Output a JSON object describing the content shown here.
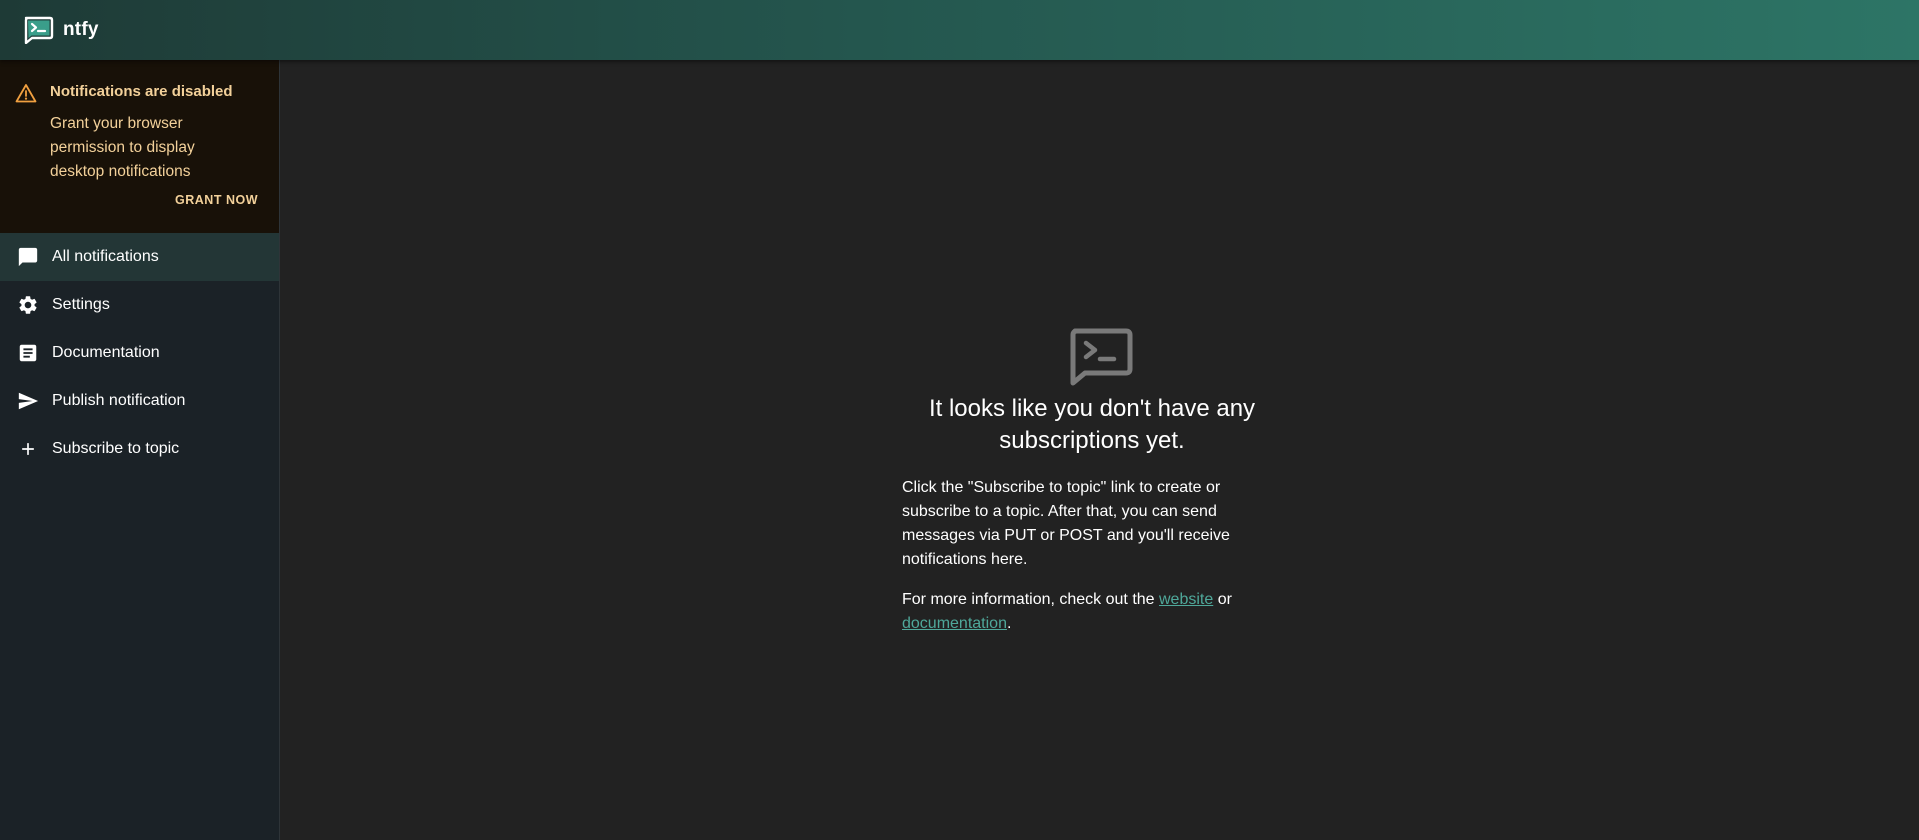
{
  "app": {
    "title": "ntfy",
    "logo_icon": "terminal-message-icon",
    "accent_color": "#338574"
  },
  "alert": {
    "icon": "warning-icon",
    "title": "Notifications are disabled",
    "body": "Grant your browser permission to display desktop notifications",
    "action_label": "GRANT NOW",
    "text_color": "#f3d19a"
  },
  "sidebar": {
    "items": [
      {
        "label": "All notifications",
        "icon": "chat-icon",
        "active": true
      },
      {
        "label": "Settings",
        "icon": "gear-icon",
        "active": false
      },
      {
        "label": "Documentation",
        "icon": "article-icon",
        "active": false
      },
      {
        "label": "Publish notification",
        "icon": "send-icon",
        "active": false
      },
      {
        "label": "Subscribe to topic",
        "icon": "plus-icon",
        "active": false
      }
    ]
  },
  "empty_state": {
    "icon": "terminal-message-icon",
    "title": "It looks like you don't have any subscriptions yet.",
    "description": "Click the \"Subscribe to topic\" link to create or subscribe to a topic. After that, you can send messages via PUT or POST and you'll receive notifications here.",
    "more_prefix": "For more information, check out the ",
    "website_link": "website",
    "more_middle": " or ",
    "documentation_link": "documentation",
    "more_suffix": "."
  }
}
